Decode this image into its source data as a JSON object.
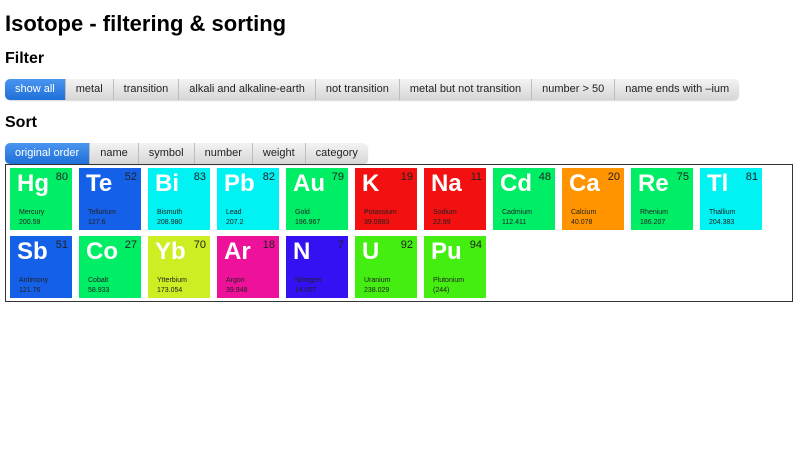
{
  "title": "Isotope - filtering & sorting",
  "filter": {
    "heading": "Filter",
    "buttons": [
      "show all",
      "metal",
      "transition",
      "alkali and alkaline-earth",
      "not transition",
      "metal but not transition",
      "number > 50",
      "name ends with –ium"
    ],
    "active": "show all"
  },
  "sort": {
    "heading": "Sort",
    "buttons": [
      "original order",
      "name",
      "symbol",
      "number",
      "weight",
      "category"
    ],
    "active": "original order"
  },
  "elements": [
    {
      "symbol": "Hg",
      "number": "80",
      "name": "Mercury",
      "weight": "200.59",
      "color": "#00ee66"
    },
    {
      "symbol": "Te",
      "number": "52",
      "name": "Tellurium",
      "weight": "127.6",
      "color": "#1560e8"
    },
    {
      "symbol": "Bi",
      "number": "83",
      "name": "Bismuth",
      "weight": "208.980",
      "color": "#00f2f2"
    },
    {
      "symbol": "Pb",
      "number": "82",
      "name": "Lead",
      "weight": "207.2",
      "color": "#00f2f2"
    },
    {
      "symbol": "Au",
      "number": "79",
      "name": "Gold",
      "weight": "196.967",
      "color": "#00ee66"
    },
    {
      "symbol": "K",
      "number": "19",
      "name": "Potassium",
      "weight": "39.0983",
      "color": "#f21010"
    },
    {
      "symbol": "Na",
      "number": "11",
      "name": "Sodium",
      "weight": "22.99",
      "color": "#f21010"
    },
    {
      "symbol": "Cd",
      "number": "48",
      "name": "Cadmium",
      "weight": "112.411",
      "color": "#00ee66"
    },
    {
      "symbol": "Ca",
      "number": "20",
      "name": "Calcium",
      "weight": "40.078",
      "color": "#ff9400"
    },
    {
      "symbol": "Re",
      "number": "75",
      "name": "Rhenium",
      "weight": "186.207",
      "color": "#00ee66"
    },
    {
      "symbol": "Tl",
      "number": "81",
      "name": "Thallium",
      "weight": "204.383",
      "color": "#00f2f2"
    },
    {
      "symbol": "Sb",
      "number": "51",
      "name": "Antimony",
      "weight": "121.76",
      "color": "#1560e8"
    },
    {
      "symbol": "Co",
      "number": "27",
      "name": "Cobalt",
      "weight": "58.933",
      "color": "#00ee66"
    },
    {
      "symbol": "Yb",
      "number": "70",
      "name": "Ytterbium",
      "weight": "173.054",
      "color": "#ccee22"
    },
    {
      "symbol": "Ar",
      "number": "18",
      "name": "Argon",
      "weight": "39.948",
      "color": "#ee1199"
    },
    {
      "symbol": "N",
      "number": "7",
      "name": "Nitrogen",
      "weight": "14.007",
      "color": "#3311f2"
    },
    {
      "symbol": "U",
      "number": "92",
      "name": "Uranium",
      "weight": "238.029",
      "color": "#44ee11"
    },
    {
      "symbol": "Pu",
      "number": "94",
      "name": "Plutonium",
      "weight": "(244)",
      "color": "#44ee11"
    }
  ]
}
